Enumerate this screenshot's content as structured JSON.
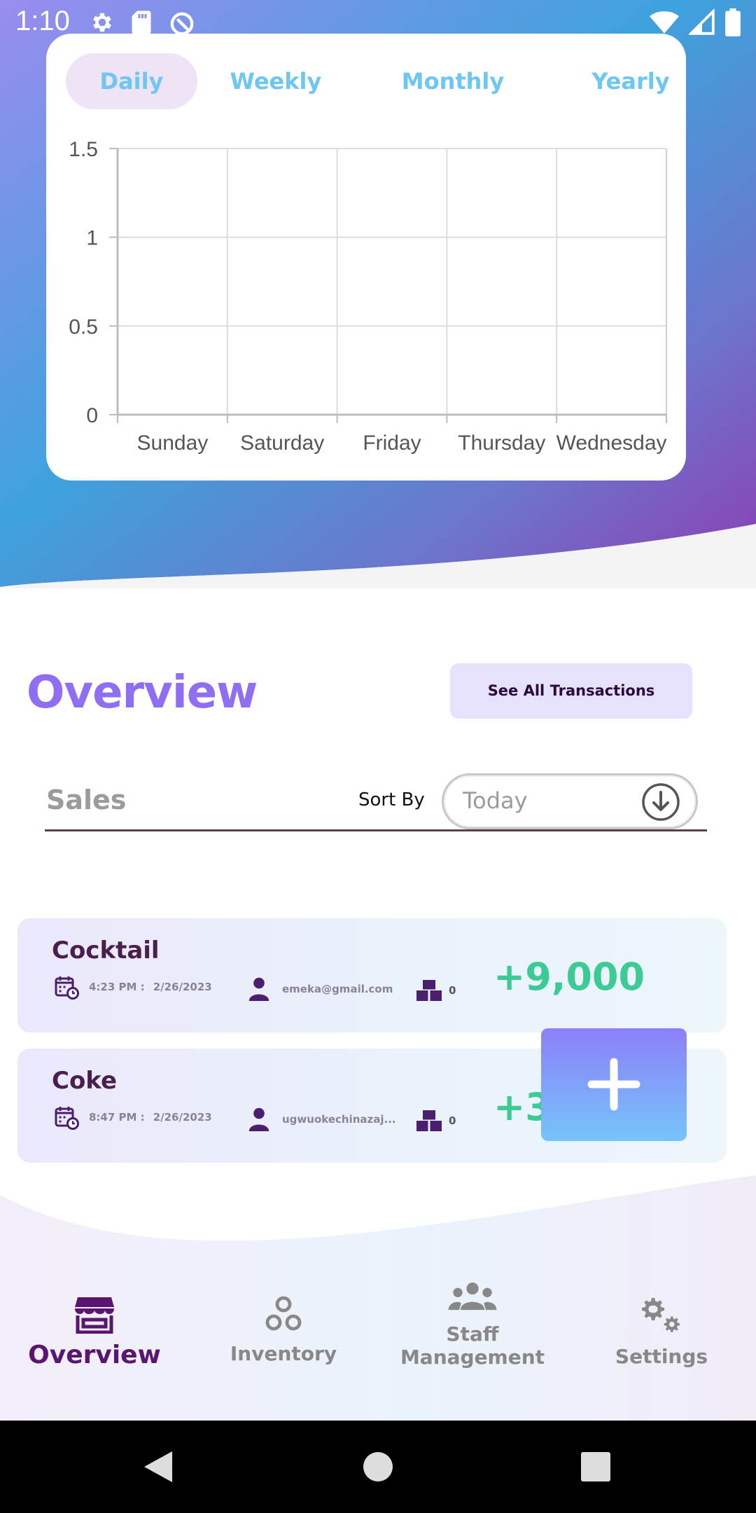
{
  "status_bar": {
    "time": "1:10"
  },
  "period_tabs": [
    {
      "label": "Daily",
      "active": true
    },
    {
      "label": "Weekly",
      "active": false
    },
    {
      "label": "Monthly",
      "active": false
    },
    {
      "label": "Yearly",
      "active": false
    }
  ],
  "chart_data": {
    "type": "bar",
    "categories": [
      "Sunday",
      "Saturday",
      "Friday",
      "Thursday",
      "Wednesday"
    ],
    "values": [
      0,
      0,
      0,
      0,
      0
    ],
    "y_ticks": [
      "0",
      "0.5",
      "1",
      "1.5"
    ],
    "ylim": [
      0,
      1.5
    ],
    "grid": true
  },
  "overview": {
    "title": "Overview",
    "see_all_label": "See All Transactions"
  },
  "sales": {
    "label": "Sales",
    "sort_by_label": "Sort By",
    "sort_value": "Today"
  },
  "transactions": [
    {
      "name": "Cocktail",
      "time": "4:23 PM :",
      "date": "2/26/2023",
      "user": "emeka@gmail.com",
      "quantity": "0",
      "amount": "+9,000"
    },
    {
      "name": "Coke",
      "time": "8:47 PM :",
      "date": "2/26/2023",
      "user": "ugwuokechinazaj...",
      "quantity": "0",
      "amount": "+3("
    }
  ],
  "bottom_nav": [
    {
      "label": "Overview",
      "icon": "store-icon",
      "active": true
    },
    {
      "label": "Inventory",
      "icon": "three-circles-icon",
      "active": false
    },
    {
      "label": "Staff\nManagement",
      "icon": "group-icon",
      "active": false
    },
    {
      "label": "Settings",
      "icon": "gears-icon",
      "active": false
    }
  ],
  "colors": {
    "accent_purple": "#8f6ef3",
    "tab_text": "#6ec6f2",
    "amount_green": "#3dcb95",
    "nav_active": "#5a1570"
  }
}
